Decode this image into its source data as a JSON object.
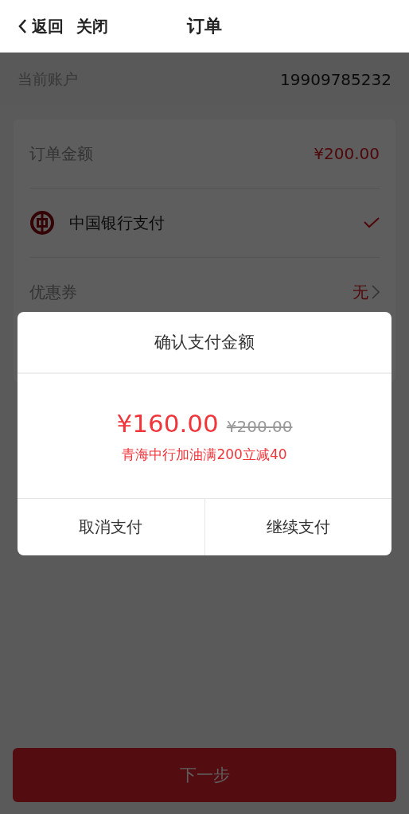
{
  "header": {
    "back_label": "返回",
    "close_label": "关闭",
    "title": "订单"
  },
  "account": {
    "label": "当前账户",
    "value": "19909785232"
  },
  "order_rows": [
    {
      "kind": "amount",
      "label": "订单金额",
      "value": "¥200.00"
    },
    {
      "kind": "payment",
      "label": "中国银行支付",
      "selected": true
    },
    {
      "kind": "link",
      "label": "优惠券",
      "value": "无"
    }
  ],
  "dialog": {
    "title": "确认支付金额",
    "price": "¥160.00",
    "original_price": "¥200.00",
    "promotion": "青海中行加油满200立减40",
    "buttons": [
      {
        "label": "取消支付"
      },
      {
        "label": "继续支付"
      }
    ]
  },
  "next_button": {
    "label": "下一步"
  }
}
